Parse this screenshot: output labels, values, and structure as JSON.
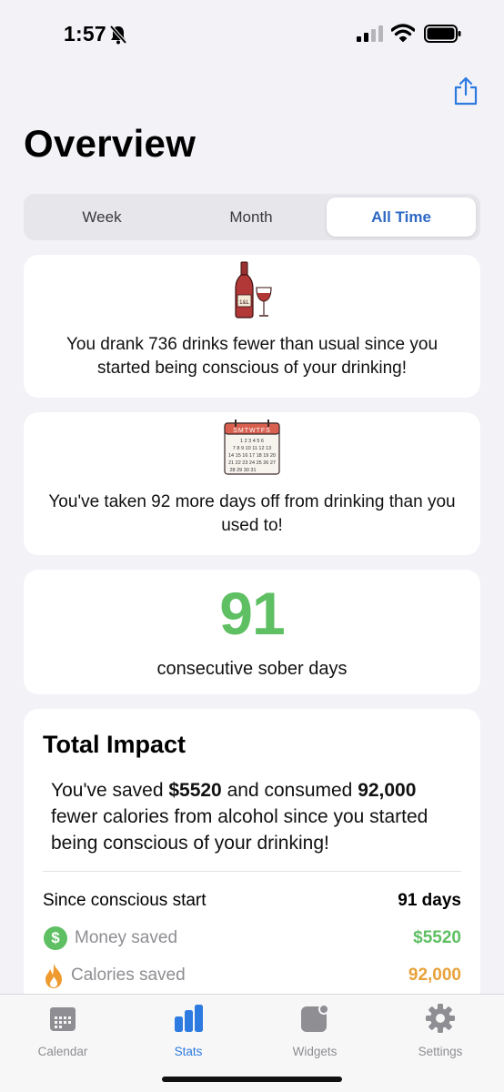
{
  "status_bar": {
    "time": "1:57"
  },
  "header": {
    "title": "Overview"
  },
  "segmented": {
    "options": [
      "Week",
      "Month",
      "All Time"
    ],
    "selected": "All Time"
  },
  "cards": {
    "drinks": {
      "text": "You drank 736 drinks fewer than usual since you started being conscious of your drinking!"
    },
    "days_off": {
      "text": "You've taken 92 more days off from drinking than you used to!"
    },
    "streak": {
      "number": "91",
      "label": "consecutive sober days"
    }
  },
  "impact": {
    "title": "Total Impact",
    "text_1": "You've saved ",
    "money_bold": "$5520",
    "text_2": " and consumed ",
    "calories_bold": "92,000",
    "text_3": " fewer calories from alcohol since you started being conscious of your drinking!",
    "since_label": "Since conscious start",
    "since_value": "91 days",
    "money_label": "Money saved",
    "money_value": "$5520",
    "calories_label": "Calories saved",
    "calories_value": "92,000",
    "money_icon_text": "$"
  },
  "calendar_icon_text": {
    "header": "SMTWTFS",
    "rows": [
      "1 2 3 4 5 6",
      "7 8 9 10 11 12 13",
      "14 15 16 17 18 19 20",
      "21 22 23 24 25 26 27",
      "28 29 30 31"
    ]
  },
  "wine_label": "1&L",
  "tabs": [
    {
      "label": "Calendar",
      "icon": "calendar-icon"
    },
    {
      "label": "Stats",
      "icon": "bar-chart-icon"
    },
    {
      "label": "Widgets",
      "icon": "widgets-icon"
    },
    {
      "label": "Settings",
      "icon": "gear-icon"
    }
  ],
  "colors": {
    "accent": "#2d68c4",
    "tab_active": "#2d7be0",
    "green": "#5ebf63",
    "orange": "#e8a23a",
    "background": "#f2f2f7"
  }
}
